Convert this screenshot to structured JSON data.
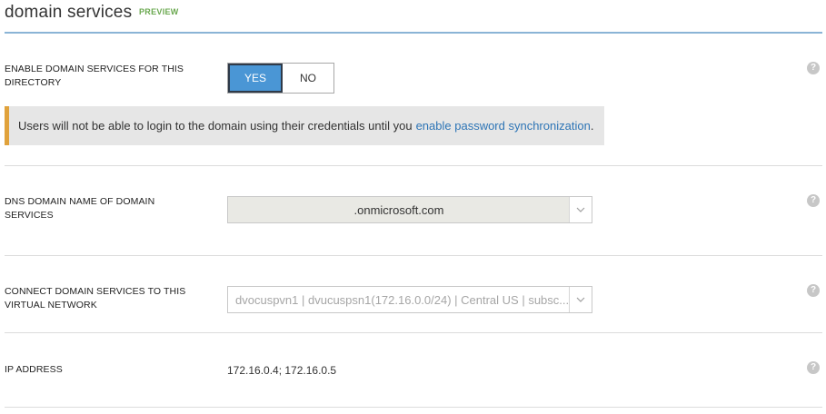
{
  "header": {
    "title": "domain services",
    "badge": "PREVIEW"
  },
  "enable_section": {
    "label": "ENABLE DOMAIN SERVICES FOR THIS DIRECTORY",
    "toggle": {
      "yes_label": "YES",
      "no_label": "NO",
      "selected": "YES"
    },
    "warning": {
      "text": "Users will not be able to login to the domain using their credentials until you",
      "link_text": "enable password synchronization",
      "suffix": ".",
      "accent_color": "#e0a23c"
    },
    "help": "?"
  },
  "dns_section": {
    "label": "DNS DOMAIN NAME OF DOMAIN SERVICES",
    "value": ".onmicrosoft.com",
    "help": "?"
  },
  "vnet_section": {
    "label": "CONNECT DOMAIN SERVICES TO THIS VIRTUAL NETWORK",
    "value": "dvocuspvn1 | dvucuspsn1(172.16.0.0/24) | Central US | subsc...",
    "help": "?"
  },
  "ip_section": {
    "label": "IP ADDRESS",
    "value": "172.16.0.4; 172.16.0.5",
    "help": "?"
  },
  "colors": {
    "accent_blue": "#4a96d5",
    "header_rule": "#8ab4d6",
    "preview_green": "#6aa84f",
    "link_blue": "#2e75b6"
  }
}
